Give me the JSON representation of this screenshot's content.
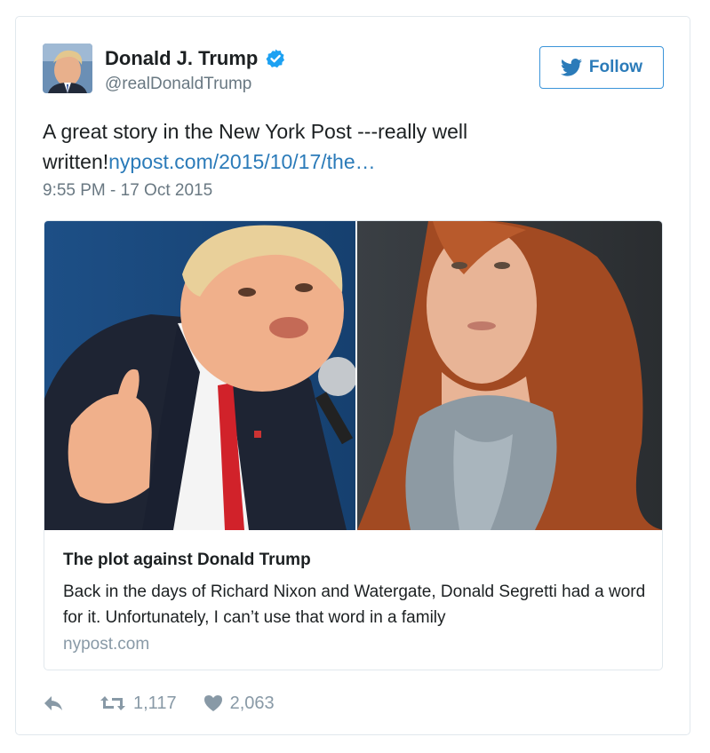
{
  "user": {
    "name": "Donald J. Trump",
    "handle": "@realDonaldTrump",
    "verified": true
  },
  "follow_label": "Follow",
  "tweet": {
    "text": "A great story in the New York Post ---really well written!",
    "link_text": "nypost.com/2015/10/17/the…",
    "timestamp": "9:55 PM - 17 Oct 2015"
  },
  "card": {
    "title": "The plot against Donald Trump",
    "description": "Back in the days of Richard Nixon and Watergate, Donald Segretti had a word for it. Unfortunately, I can’t use that word in a family",
    "domain": "nypost.com"
  },
  "actions": {
    "reply_icon": "reply-icon",
    "retweet_icon": "retweet-icon",
    "retweet_count": "1,117",
    "like_icon": "heart-icon",
    "like_count": "2,063"
  },
  "colors": {
    "link": "#2b7bb9",
    "verified": "#1da1f2",
    "muted": "#8899a6",
    "border": "#e1e8ed"
  }
}
